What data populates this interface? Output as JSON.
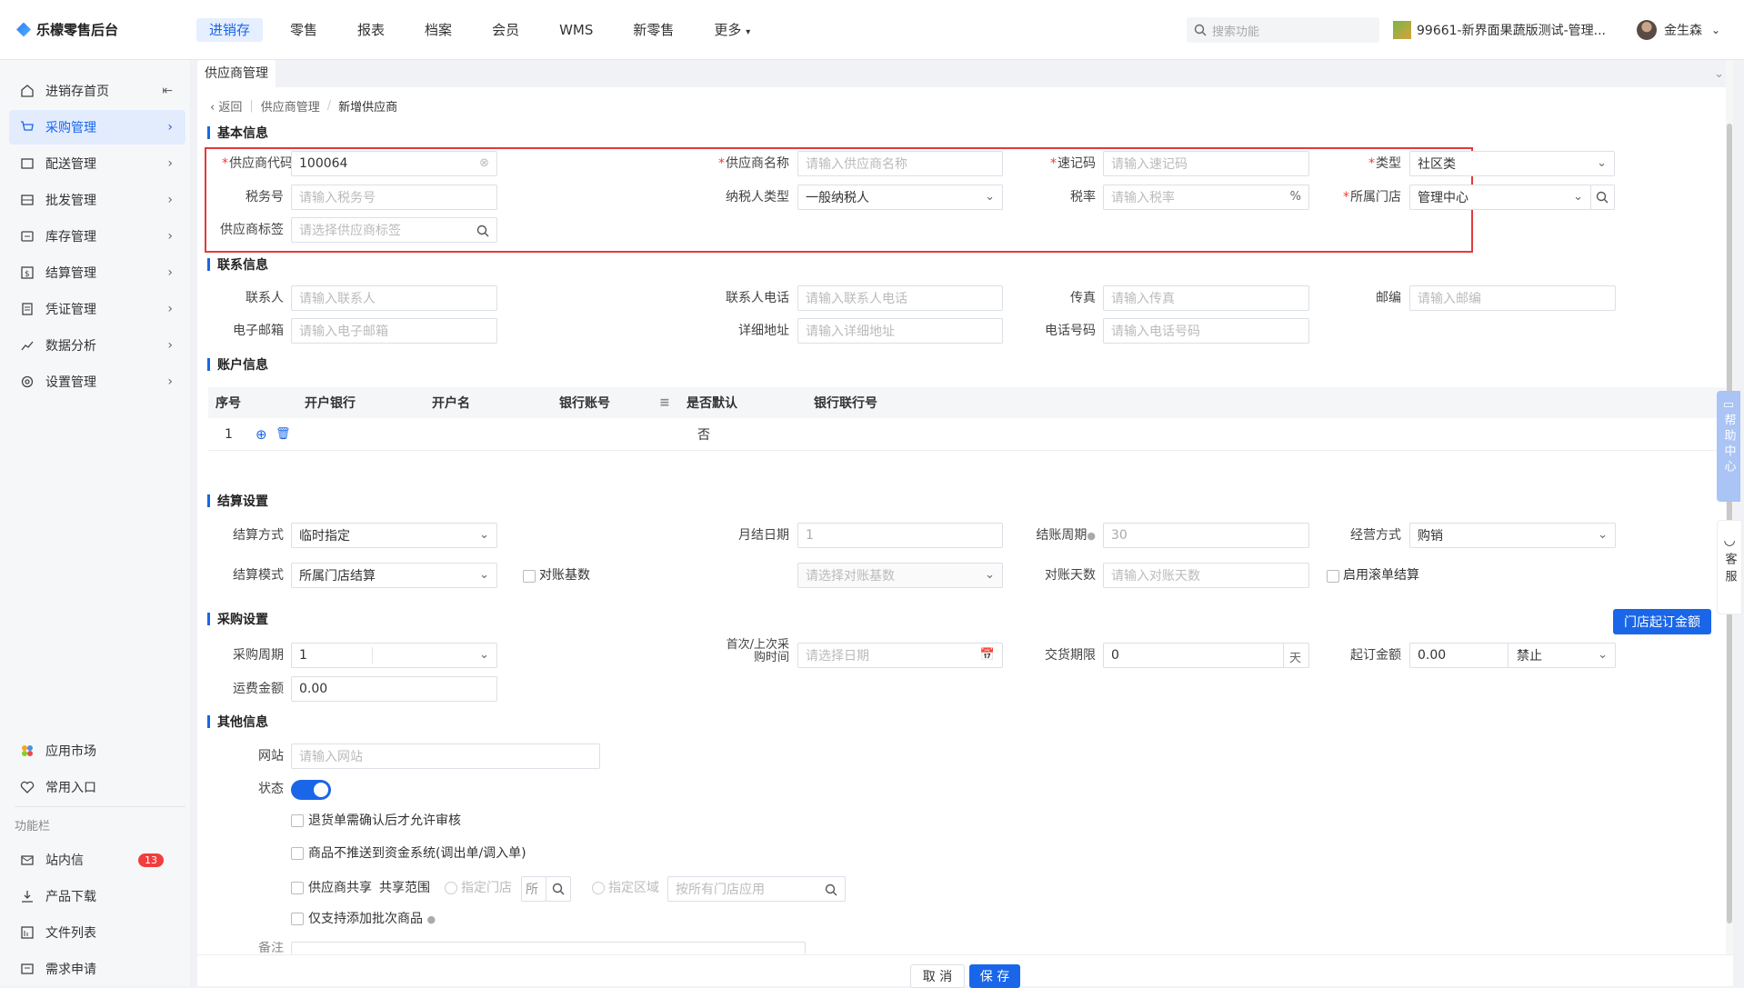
{
  "brand": {
    "name": "乐檬零售后台"
  },
  "topnav": [
    "进销存",
    "零售",
    "报表",
    "档案",
    "会员",
    "WMS",
    "新零售",
    "更多"
  ],
  "search": {
    "placeholder": "搜索功能"
  },
  "shop": {
    "name": "99661-新界面果蔬版测试-管理..."
  },
  "user": {
    "name": "金生森"
  },
  "sidebar": {
    "items": [
      "进销存首页",
      "采购管理",
      "配送管理",
      "批发管理",
      "库存管理",
      "结算管理",
      "凭证管理",
      "数据分析",
      "设置管理"
    ],
    "bottom_items": [
      "应用市场",
      "常用入口"
    ],
    "section_label": "功能栏",
    "func_items": [
      "站内信",
      "产品下载",
      "文件列表",
      "需求申请"
    ],
    "badge": "13"
  },
  "tab": {
    "label": "供应商管理"
  },
  "breadcrumb": {
    "back": "返回",
    "parent": "供应商管理",
    "current": "新增供应商"
  },
  "basic": {
    "title": "基本信息",
    "code_label": "供应商代码",
    "code_value": "100064",
    "name_label": "供应商名称",
    "name_ph": "请输入供应商名称",
    "quick_label": "速记码",
    "quick_ph": "请输入速记码",
    "type_label": "类型",
    "type_value": "社区类",
    "tax_label": "税务号",
    "tax_ph": "请输入税务号",
    "taxpayer_label": "纳税人类型",
    "taxpayer_value": "一般纳税人",
    "rate_label": "税率",
    "rate_ph": "请输入税率",
    "rate_suffix": "%",
    "store_label": "所属门店",
    "store_value": "管理中心",
    "tag_label": "供应商标签",
    "tag_ph": "请选择供应商标签"
  },
  "contact": {
    "title": "联系信息",
    "person_label": "联系人",
    "person_ph": "请输入联系人",
    "phone_label": "联系人电话",
    "phone_ph": "请输入联系人电话",
    "fax_label": "传真",
    "fax_ph": "请输入传真",
    "zip_label": "邮编",
    "zip_ph": "请输入邮编",
    "email_label": "电子邮箱",
    "email_ph": "请输入电子邮箱",
    "addr_label": "详细地址",
    "addr_ph": "请输入详细地址",
    "tel_label": "电话号码",
    "tel_ph": "请输入电话号码"
  },
  "account": {
    "title": "账户信息",
    "columns": [
      "序号",
      "开户银行",
      "开户名",
      "银行账号",
      "是否默认",
      "银行联行号"
    ],
    "row": {
      "index": "1",
      "default": "否"
    }
  },
  "settle": {
    "title": "结算设置",
    "method_label": "结算方式",
    "method_value": "临时指定",
    "monthday_label": "月结日期",
    "monthday_value": "1",
    "cycle_label": "结账周期",
    "cycle_value": "30",
    "biz_label": "经营方式",
    "biz_value": "购销",
    "mode_label": "结算模式",
    "mode_value": "所属门店结算",
    "base_label": "对账基数",
    "base_ph": "请选择对账基数",
    "days_label": "对账天数",
    "days_ph": "请输入对账天数",
    "roll_label": "启用滚单结算"
  },
  "purchase": {
    "title": "采购设置",
    "btn_min": "门店起订金额",
    "cycle_label": "采购周期",
    "cycle_value": "1",
    "time_label1": "首次/上次采",
    "time_label2": "购时间",
    "time_ph": "请选择日期",
    "deliver_label": "交货期限",
    "deliver_value": "0",
    "deliver_unit": "天",
    "min_label": "起订金额",
    "min_value": "0.00",
    "min_mode": "禁止",
    "freight_label": "运费金额",
    "freight_value": "0.00"
  },
  "other": {
    "title": "其他信息",
    "site_label": "网站",
    "site_ph": "请输入网站",
    "status_label": "状态",
    "cb1": "退货单需确认后才允许审核",
    "cb2": "商品不推送到资金系统(调出单/调入单)",
    "cb3": "供应商共享",
    "share_range": "共享范围",
    "radio1": "指定门店",
    "radio2": "指定区域",
    "region_ph": "按所有门店应用",
    "cb4": "仅支持添加批次商品",
    "remark_label": "备注"
  },
  "footer": {
    "cancel": "取 消",
    "save": "保 存"
  },
  "help": {
    "label": "帮助中心"
  },
  "kefu": {
    "label": "客服"
  }
}
